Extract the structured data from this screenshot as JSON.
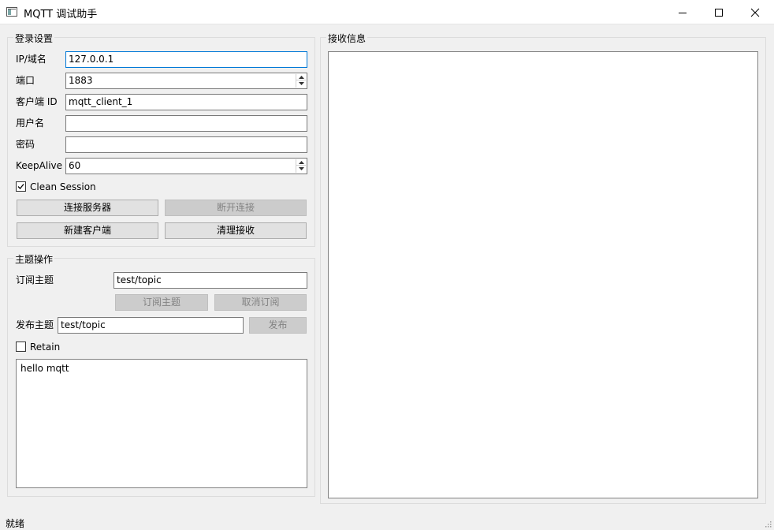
{
  "window": {
    "title": "MQTT 调试助手",
    "icon": "app-window-icon"
  },
  "login": {
    "group_title": "登录设置",
    "ip_label": "IP/域名",
    "ip_value": "127.0.0.1",
    "port_label": "端口",
    "port_value": "1883",
    "client_id_label": "客户端 ID",
    "client_id_value": "mqtt_client_1",
    "username_label": "用户名",
    "username_value": "",
    "password_label": "密码",
    "password_value": "",
    "keepalive_label": "KeepAlive",
    "keepalive_value": "60",
    "clean_session_label": "Clean Session",
    "clean_session_checked": true,
    "connect_label": "连接服务器",
    "disconnect_label": "断开连接",
    "new_client_label": "新建客户端",
    "clear_receive_label": "清理接收"
  },
  "topic": {
    "group_title": "主题操作",
    "subscribe_label": "订阅主题",
    "subscribe_value": "test/topic",
    "subscribe_btn": "订阅主题",
    "unsubscribe_btn": "取消订阅",
    "publish_label": "发布主题",
    "publish_value": "test/topic",
    "publish_btn": "发布",
    "retain_label": "Retain",
    "retain_checked": false,
    "message_text": "hello mqtt"
  },
  "receive": {
    "group_title": "接收信息",
    "content": ""
  },
  "status": {
    "text": "就绪"
  },
  "colors": {
    "focus_border": "#0078d7",
    "disabled_button_bg": "#cccccc",
    "disabled_text": "#838383"
  }
}
